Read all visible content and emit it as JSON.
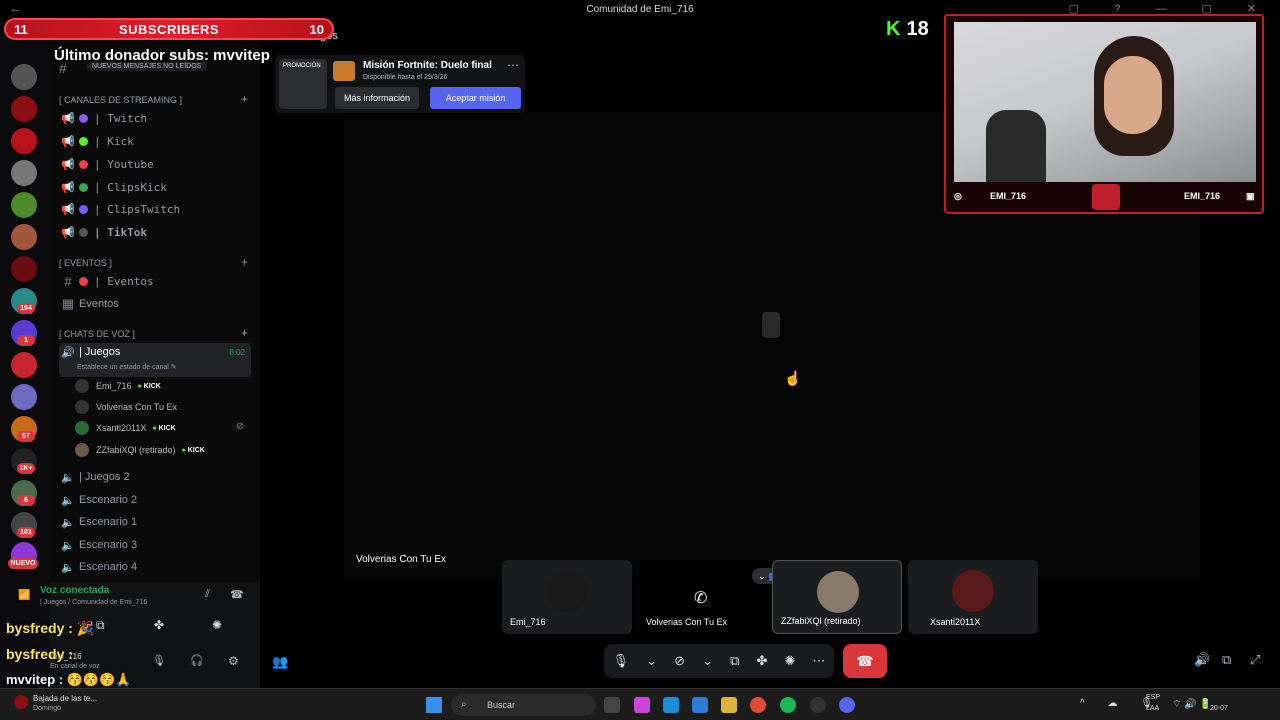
{
  "window": {
    "title": "Comunidad de Emi_716",
    "back_icon": "←",
    "controls": "▢ ? — ▢ ✕"
  },
  "overlay": {
    "subs_left": "11",
    "subs_label": "SUBSCRIBERS",
    "subs_right": "10",
    "donor_text": "Último donador subs: mvvitep",
    "kick_count": "18",
    "new_messages": "NUEVOS MENSAJES NO LEÍDOS",
    "chat_lines": [
      {
        "user": "bysfredy :",
        "emote": "🎉"
      },
      {
        "user": "bysfredy :",
        "emote": ""
      },
      {
        "user": "mvvitep :",
        "emote": "😚😚😚🙏"
      }
    ],
    "cam_left_handle": "EMI_716",
    "cam_right_handle": "EMI_716"
  },
  "server_badges": [
    "194",
    "1",
    "57",
    "1K+",
    "6",
    "101",
    "NUEVO"
  ],
  "channels": {
    "header_partial": "gos",
    "categories": {
      "streaming": "[ CANALES DE STREAMING ]",
      "eventos": "[ EVENTOS ]",
      "voz": "[ CHATS DE VOZ ]"
    },
    "streaming": [
      {
        "label": "| Twitch",
        "color": "#8b5cf6"
      },
      {
        "label": "| Kick",
        "color": "#53fc18"
      },
      {
        "label": "| Youtube",
        "color": "#f23f43"
      },
      {
        "label": "| ClipsKick",
        "color": "#3ba55c"
      },
      {
        "label": "| ClipsTwitch",
        "color": "#7c5cf6"
      },
      {
        "label": "| TikTok",
        "color": "#555"
      }
    ],
    "eventos": [
      {
        "label": "| Eventos"
      },
      {
        "label": "Eventos"
      }
    ],
    "active_voice": {
      "label": "| Juegos",
      "timer": "8:02",
      "status": "Establece un estado de canal ✎"
    },
    "members": [
      {
        "name": "Emi_716",
        "kick": true
      },
      {
        "name": "Volverias Con Tu Ex",
        "kick": false
      },
      {
        "name": "Xsanti2011X",
        "kick": true
      },
      {
        "name": "ZZfabiXQl (retirado)",
        "kick": true
      }
    ],
    "kick_label": "KICK",
    "voice_channels": [
      "| Juegos 2",
      "Escenario 2",
      "Escenario 1",
      "Escenario 3",
      "Escenario 4"
    ]
  },
  "voice_panel": {
    "status": "Voz conectada",
    "location": "| Juegos / Comunidad de Emi_716",
    "user": "Emi_716",
    "user_sub": "En canal de voz"
  },
  "quest": {
    "promo": "PROMOCIÓN",
    "title": "Misión Fortnite: Duelo final",
    "subtitle": "Disponible hasta el 29/3/26",
    "more_info": "Más información",
    "accept": "Aceptar misión",
    "more_icon": "⋯"
  },
  "stage": {
    "speaker_label": "Volverias Con Tu Ex"
  },
  "tiles": [
    {
      "name": "Emi_716"
    },
    {
      "name": "Volverias Con Tu Ex"
    },
    {
      "name": "ZZfabiXQl (retirado)"
    },
    {
      "name": "Xsanti2011X"
    }
  ],
  "taskbar": {
    "notification": "Bajada de las te...",
    "notification_sub": "Domingo",
    "search_placeholder": "Buscar",
    "lang": "ESP",
    "lang_sub": "LAA",
    "date": "20-07"
  }
}
